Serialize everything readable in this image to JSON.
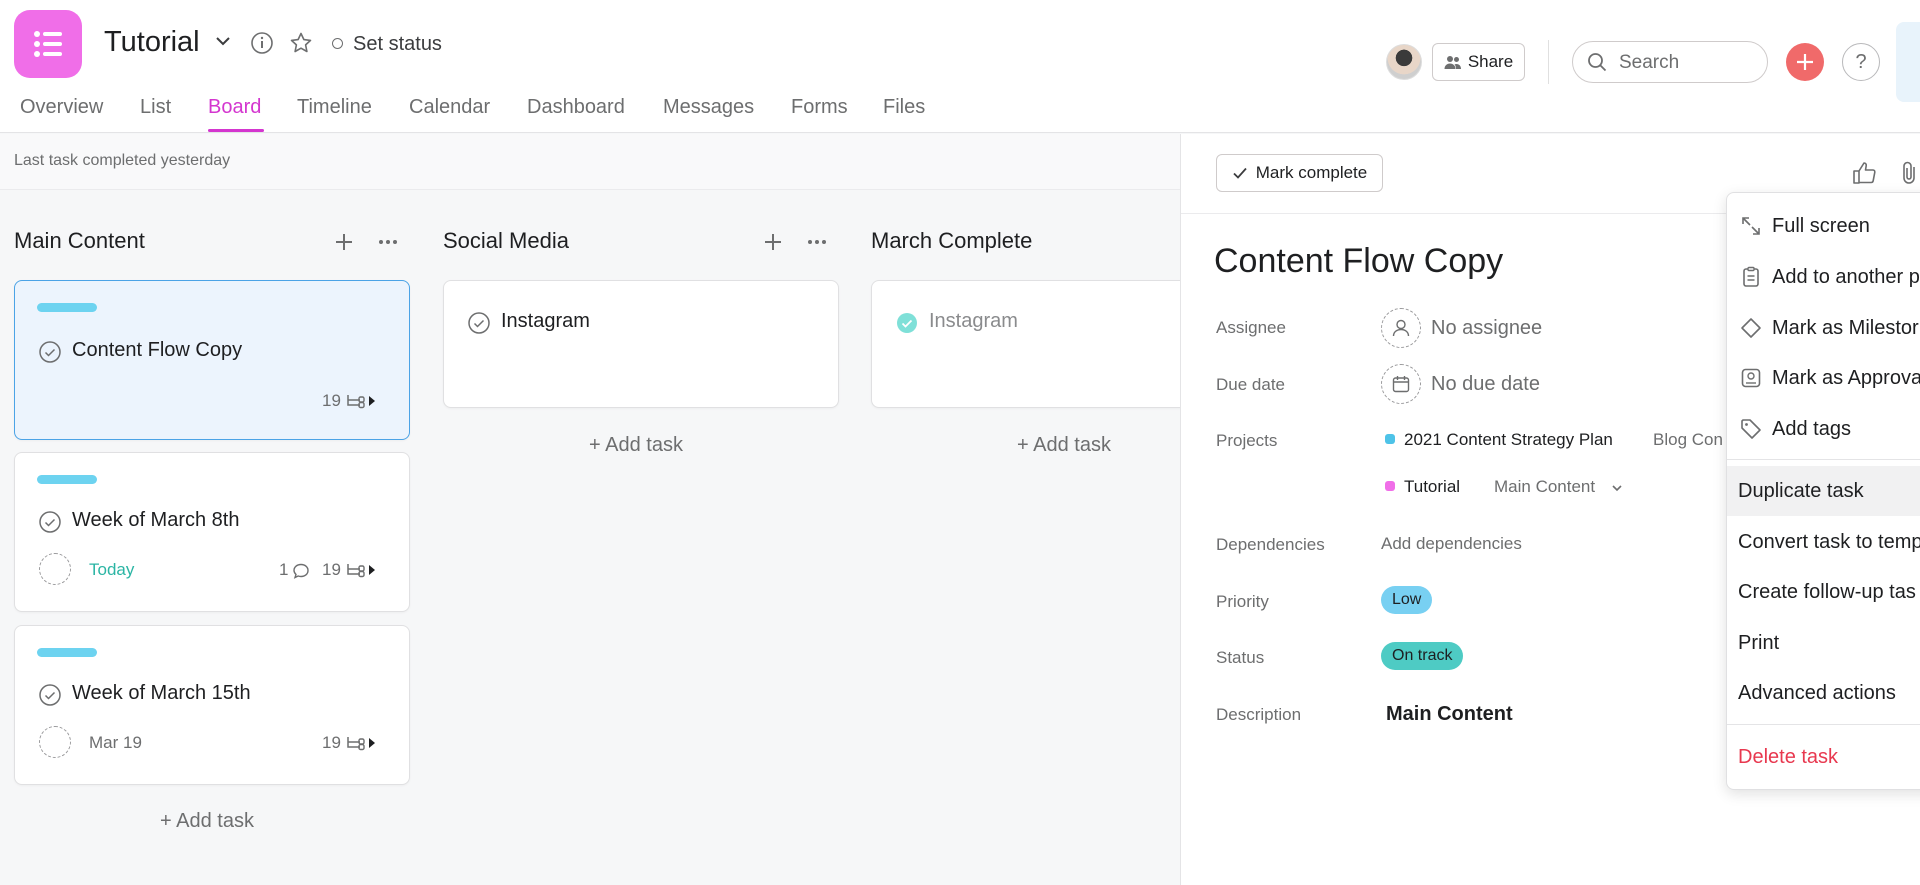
{
  "project": {
    "title": "Tutorial",
    "set_status": "Set status"
  },
  "tabs": [
    "Overview",
    "List",
    "Board",
    "Timeline",
    "Calendar",
    "Dashboard",
    "Messages",
    "Forms",
    "Files"
  ],
  "active_tab": "Board",
  "topbar": {
    "share_label": "Share",
    "search_placeholder": "Search",
    "help_label": "?"
  },
  "board": {
    "last_completed": "Last task completed yesterday",
    "add_task_label": "+ Add task",
    "columns": [
      {
        "title": "Main Content",
        "cards": [
          {
            "title": "Content Flow Copy",
            "subtasks": "19"
          },
          {
            "title": "Week of March 8th",
            "due": "Today",
            "comments": "1",
            "subtasks": "19"
          },
          {
            "title": "Week of March 15th",
            "due": "Mar 19",
            "subtasks": "19"
          }
        ]
      },
      {
        "title": "Social Media",
        "cards": [
          {
            "title": "Instagram"
          }
        ]
      },
      {
        "title": "March Complete",
        "cards": [
          {
            "title": "Instagram",
            "completed": true
          }
        ]
      }
    ]
  },
  "detail": {
    "mark_complete": "Mark complete",
    "title": "Content Flow Copy",
    "labels": {
      "assignee": "Assignee",
      "due_date": "Due date",
      "projects": "Projects",
      "dependencies": "Dependencies",
      "priority": "Priority",
      "status": "Status",
      "description": "Description"
    },
    "assignee_value": "No assignee",
    "due_value": "No due date",
    "projects": [
      {
        "name": "2021 Content Strategy Plan",
        "section": "Blog Con",
        "color": "#4ec3e8"
      },
      {
        "name": "Tutorial",
        "section": "Main Content",
        "color": "#f06ee8"
      }
    ],
    "dependencies_value": "Add dependencies",
    "priority_value": "Low",
    "priority_color": "#78d0f2",
    "status_value": "On track",
    "status_color": "#4ecbc4",
    "description_value": "Main Content"
  },
  "menu": {
    "items": [
      {
        "label": "Full screen",
        "icon": "expand-icon"
      },
      {
        "label": "Add to another p",
        "icon": "clipboard-icon"
      },
      {
        "label": "Mark as Milestor",
        "icon": "diamond-icon"
      },
      {
        "label": "Mark as Approva",
        "icon": "approval-icon"
      },
      {
        "label": "Add tags",
        "icon": "tag-icon"
      },
      {
        "label": "Duplicate task"
      },
      {
        "label": "Convert task to temp"
      },
      {
        "label": "Create follow-up tas"
      },
      {
        "label": "Print"
      },
      {
        "label": "Advanced actions"
      },
      {
        "label": "Delete task",
        "danger": true
      }
    ]
  },
  "colors": {
    "accent": "#d436cf",
    "app_icon": "#f06ee8",
    "card_bar": "#6dd3f0",
    "today": "#2bb5a4",
    "danger": "#e8384f",
    "plus": "#f06a6a"
  }
}
